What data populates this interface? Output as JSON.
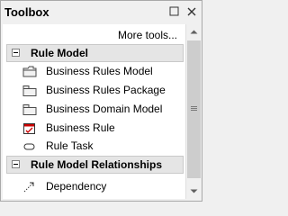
{
  "window": {
    "title": "Toolbox"
  },
  "toolbar": {
    "more_tools": "More tools..."
  },
  "sections": [
    {
      "label": "Rule Model",
      "items": [
        {
          "label": "Business Rules Model",
          "icon": "folder-icon"
        },
        {
          "label": "Business Rules Package",
          "icon": "package-icon"
        },
        {
          "label": "Business Domain Model",
          "icon": "package-icon"
        },
        {
          "label": "Business Rule",
          "icon": "rule-icon"
        },
        {
          "label": "Rule Task",
          "icon": "task-icon"
        }
      ]
    },
    {
      "label": "Rule Model Relationships",
      "items": [
        {
          "label": "Dependency",
          "icon": "dependency-icon"
        }
      ]
    }
  ],
  "colors": {
    "section_bg": "#e5e5e5",
    "panel_bg": "#ffffff",
    "chrome_bg": "#f0f0f0",
    "rule_icon_red": "#cc0000"
  }
}
